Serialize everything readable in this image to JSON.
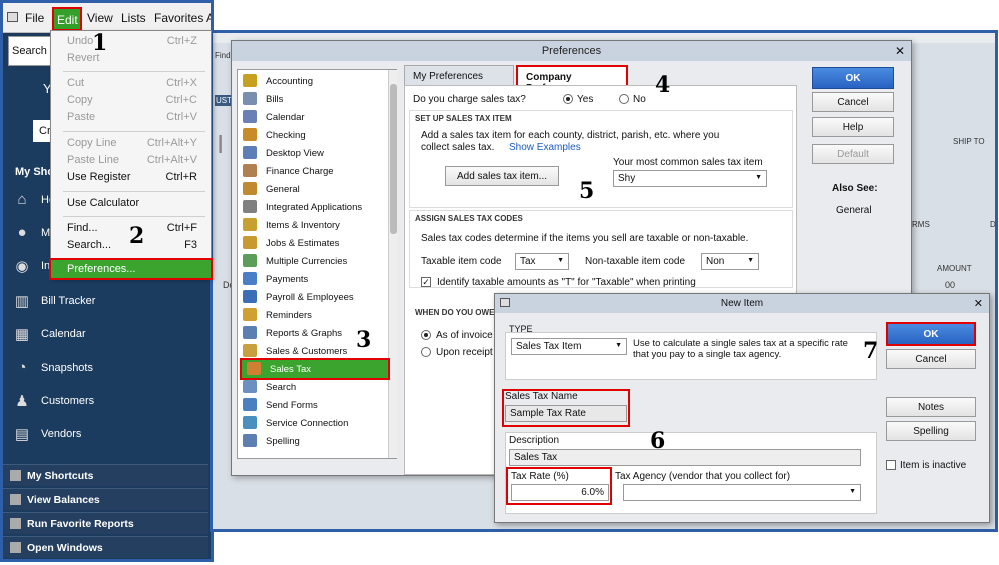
{
  "menubar": {
    "items": [
      "File",
      "Edit",
      "View",
      "Lists",
      "Favorites",
      "A"
    ]
  },
  "left": {
    "search_placeholder": "Search C",
    "you_label": "Y",
    "cr_label": "Cr",
    "my_shortcuts_header": "My Sho",
    "nav": [
      {
        "label": "Ho",
        "icon": "home-icon"
      },
      {
        "label": "My",
        "icon": "my-company-icon"
      },
      {
        "label": "In",
        "icon": "income-tracker-icon"
      },
      {
        "label": "Bill Tracker",
        "icon": "bill-tracker-icon"
      },
      {
        "label": "Calendar",
        "icon": "calendar-icon"
      },
      {
        "label": "Snapshots",
        "icon": "snapshots-icon"
      },
      {
        "label": "Customers",
        "icon": "customers-icon"
      },
      {
        "label": "Vendors",
        "icon": "vendors-icon"
      }
    ],
    "sections": [
      "My Shortcuts",
      "View Balances",
      "Run Favorite Reports",
      "Open Windows"
    ]
  },
  "edit_menu": {
    "items": [
      {
        "label": "Undo",
        "key": "Ctrl+Z",
        "disabled": true
      },
      {
        "label": "Revert",
        "key": "",
        "disabled": true
      },
      {
        "label": "Cut",
        "key": "Ctrl+X",
        "disabled": true
      },
      {
        "label": "Copy",
        "key": "Ctrl+C",
        "disabled": true
      },
      {
        "label": "Paste",
        "key": "Ctrl+V",
        "disabled": true
      },
      {
        "label": "Copy Line",
        "key": "Ctrl+Alt+Y",
        "disabled": true
      },
      {
        "label": "Paste Line",
        "key": "Ctrl+Alt+V",
        "disabled": true
      },
      {
        "label": "Use Register",
        "key": "Ctrl+R",
        "disabled": false
      },
      {
        "label": "Use Calculator",
        "key": "",
        "disabled": false
      },
      {
        "label": "Find...",
        "key": "Ctrl+F",
        "disabled": false
      },
      {
        "label": "Search...",
        "key": "F3",
        "disabled": false
      },
      {
        "label": "Preferences...",
        "key": "",
        "disabled": false
      }
    ]
  },
  "steps": [
    "1",
    "2",
    "3",
    "4",
    "5",
    "6",
    "7"
  ],
  "bg": {
    "find": "Find",
    "ust": "UST",
    "big_i": "I",
    "ship_to": "SHIP TO",
    "rms": "RMS",
    "amount": "AMOUNT",
    "d": "D",
    "zeros": "00",
    "do": "Do"
  },
  "preferences": {
    "title": "Preferences",
    "categories": [
      {
        "label": "Accounting",
        "color": "#c8a020"
      },
      {
        "label": "Bills",
        "color": "#7a8fb0"
      },
      {
        "label": "Calendar",
        "color": "#6a7fb5"
      },
      {
        "label": "Checking",
        "color": "#c98a2a"
      },
      {
        "label": "Desktop View",
        "color": "#5d7fb8"
      },
      {
        "label": "Finance Charge",
        "color": "#b08050"
      },
      {
        "label": "General",
        "color": "#c08a30"
      },
      {
        "label": "Integrated Applications",
        "color": "#808080"
      },
      {
        "label": "Items & Inventory",
        "color": "#c8a030"
      },
      {
        "label": "Jobs & Estimates",
        "color": "#c89a30"
      },
      {
        "label": "Multiple Currencies",
        "color": "#5a9e5a"
      },
      {
        "label": "Payments",
        "color": "#4a7fc8"
      },
      {
        "label": "Payroll & Employees",
        "color": "#3a6fb8"
      },
      {
        "label": "Reminders",
        "color": "#d0a030"
      },
      {
        "label": "Reports & Graphs",
        "color": "#5a7fb0"
      },
      {
        "label": "Sales & Customers",
        "color": "#c8a040"
      },
      {
        "label": "Sales Tax",
        "color": "#d08030"
      },
      {
        "label": "Search",
        "color": "#6a8fc0"
      },
      {
        "label": "Send Forms",
        "color": "#4a7fc0"
      },
      {
        "label": "Service Connection",
        "color": "#4a8fc0"
      },
      {
        "label": "Spelling",
        "color": "#5a7fb0"
      }
    ],
    "tab_my": "My Preferences",
    "tab_company": "Company Preferences",
    "charge_question": "Do you charge sales tax?",
    "yes": "Yes",
    "no": "No",
    "setup_header": "SET UP SALES TAX ITEM",
    "setup_text1": "Add a sales tax item for each county, district, parish, etc. where you",
    "setup_text2": "collect sales tax.",
    "show_examples": "Show Examples",
    "add_button": "Add sales tax item...",
    "common_label": "Your most common sales tax item",
    "common_value": "Shy",
    "assign_header": "ASSIGN SALES TAX CODES",
    "assign_text": "Sales tax codes determine if the items you sell are taxable or non-taxable.",
    "taxable_label": "Taxable item code",
    "taxable_value": "Tax",
    "nontaxable_label": "Non-taxable item code",
    "nontaxable_value": "Non",
    "identify_label": "Identify taxable amounts as \"T\" for \"Taxable\" when printing",
    "when_header": "WHEN DO YOU OWE",
    "as_of_invoice": "As of invoice",
    "upon_receipt": "Upon receipt",
    "ok": "OK",
    "cancel": "Cancel",
    "help": "Help",
    "default": "Default",
    "also_see": "Also See:",
    "also_general": "General"
  },
  "new_item": {
    "title": "New Item",
    "type_label": "TYPE",
    "type_value": "Sales Tax Item",
    "type_desc1": "Use to calculate a single sales tax at a specific rate",
    "type_desc2": "that you pay to a single tax agency.",
    "name_label": "Sales Tax Name",
    "name_value": "Sample Tax Rate",
    "desc_label": "Description",
    "desc_value": "Sales Tax",
    "rate_label": "Tax Rate (%)",
    "rate_value": "6.0%",
    "agency_label": "Tax Agency (vendor that you collect for)",
    "ok": "OK",
    "cancel": "Cancel",
    "notes": "Notes",
    "spelling": "Spelling",
    "inactive": "Item is inactive"
  }
}
